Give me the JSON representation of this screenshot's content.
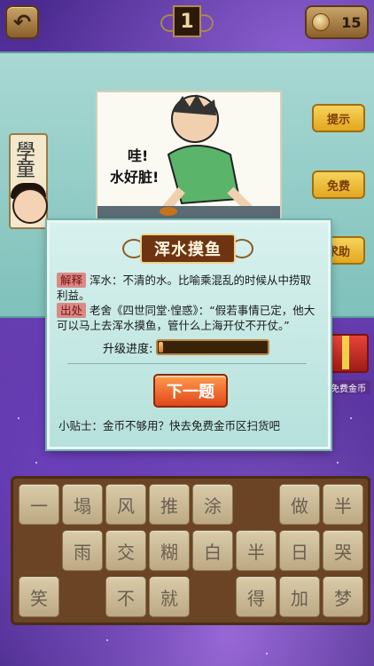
{
  "header": {
    "back_icon": "back-arrow-icon",
    "level": "1",
    "coins": "15"
  },
  "side_buttons": [
    "提示",
    "免费",
    "求助"
  ],
  "picture": {
    "speech": [
      "哇!",
      "水好脏!"
    ]
  },
  "banner_text": "學童",
  "gift_label": "免费金币",
  "dialog": {
    "title": "浑水摸鱼",
    "explain_tag": "解释",
    "explain_text": "浑水：不清的水。比喻乘混乱的时候从中捞取利益。",
    "source_tag": "出处",
    "source_text": "老舍《四世同堂·惶惑》：“假若事情已定，他大可以马上去浑水摸鱼，管什么上海开仗不开仗。”",
    "progress_label": "升级进度:",
    "progress": 0.04,
    "next_button": "下一题",
    "tip": "小贴士：金币不够用？快去免费金币区扫货吧"
  },
  "keyboard": {
    "rows": [
      [
        "一",
        "塌",
        "风",
        "推",
        "涂",
        "",
        "做",
        "半"
      ],
      [
        "",
        "雨",
        "交",
        "糊",
        "白",
        "半",
        "日",
        "哭"
      ],
      [
        "笑",
        "",
        "不",
        "就",
        "",
        "得",
        "加",
        "梦"
      ]
    ]
  }
}
